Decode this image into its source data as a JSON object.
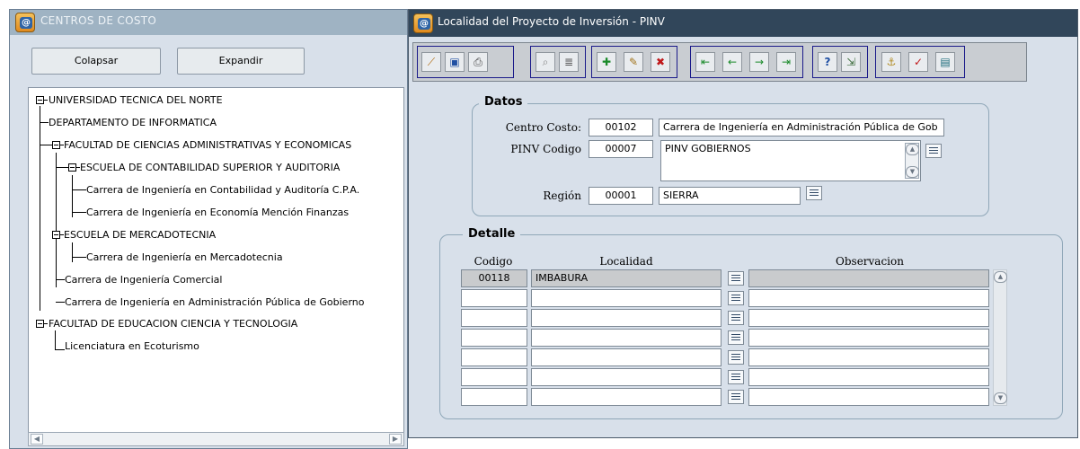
{
  "left_window": {
    "title": "CENTROS DE COSTO",
    "collapse_label": "Colapsar",
    "expand_label": "Expandir",
    "tree": {
      "root": "UNIVERSIDAD TECNICA DEL NORTE",
      "dept_info": "DEPARTAMENTO DE INFORMATICA",
      "fac_admin": "FACULTAD DE CIENCIAS ADMINISTRATIVAS Y ECONOMICAS",
      "esc_contab": "ESCUELA DE CONTABILIDAD SUPERIOR Y AUDITORIA",
      "car_contab": "Carrera de Ingeniería en Contabilidad y Auditoría C.P.A.",
      "car_econ": "Carrera de Ingeniería en Economía Mención Finanzas",
      "esc_merc": "ESCUELA DE MERCADOTECNIA",
      "car_merc": "Carrera de Ingeniería en Mercadotecnia",
      "car_comercial": "Carrera de Ingeniería Comercial",
      "car_adm_pub": "Carrera de Ingeniería en Administración Pública de Gobierno",
      "fac_educ": "FACULTAD DE EDUCACION CIENCIA Y TECNOLOGIA",
      "lic_eco": "Licenciatura en Ecoturismo"
    }
  },
  "right_window": {
    "title": "Localidad del Proyecto de Inversión - PINV",
    "datos": {
      "legend": "Datos",
      "centro_costo_label": "Centro Costo:",
      "centro_costo_code": "00102",
      "centro_costo_name": "Carrera de Ingeniería en Administración Pública de Gob",
      "pinv_label": "PINV Codigo",
      "pinv_code": "00007",
      "pinv_name": "PINV GOBIERNOS",
      "region_label": "Región",
      "region_code": "00001",
      "region_name": "SIERRA"
    },
    "detalle": {
      "legend": "Detalle",
      "headers": {
        "codigo": "Codigo",
        "localidad": "Localidad",
        "observacion": "Observacion"
      },
      "rows": [
        {
          "codigo": "00118",
          "localidad": "IMBABURA",
          "observacion": ""
        },
        {
          "codigo": "",
          "localidad": "",
          "observacion": ""
        },
        {
          "codigo": "",
          "localidad": "",
          "observacion": ""
        },
        {
          "codigo": "",
          "localidad": "",
          "observacion": ""
        },
        {
          "codigo": "",
          "localidad": "",
          "observacion": ""
        },
        {
          "codigo": "",
          "localidad": "",
          "observacion": ""
        },
        {
          "codigo": "",
          "localidad": "",
          "observacion": ""
        }
      ]
    },
    "toolbar_icons": [
      "broom-icon",
      "save-icon",
      "printer-icon",
      "search-icon",
      "list-icon",
      "insert-record-icon",
      "edit-record-icon",
      "delete-record-icon",
      "first-record-icon",
      "previous-record-icon",
      "next-record-icon",
      "last-record-icon",
      "help-icon",
      "exit-icon",
      "anchor-icon",
      "check-icon",
      "calendar-icon"
    ]
  },
  "colors": {
    "left_title_bg": "#9fb3c3",
    "right_title_bg": "#31465a",
    "window_bg": "#d8e0ea",
    "toolbar_group_border": "#1a1a8a"
  }
}
